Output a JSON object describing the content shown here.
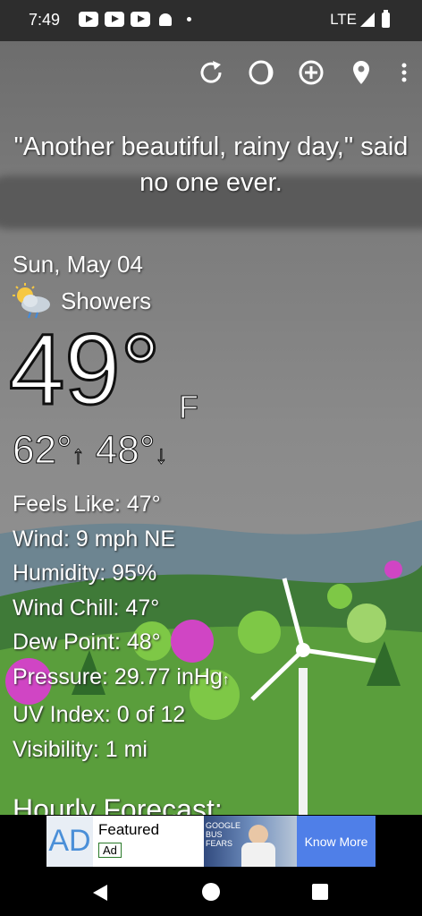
{
  "status_bar": {
    "time": "7:49",
    "network": "LTE"
  },
  "quote": "\"Another beautiful, rainy day,\" said no one ever.",
  "weather": {
    "date": "Sun, May 04",
    "condition": "Showers",
    "condition_icon": "sun-cloud-rain-icon",
    "temperature": "49°",
    "unit": "F",
    "high": "62°",
    "low": "48°",
    "details": {
      "feels_like": "Feels Like:  47°",
      "wind": "Wind:  9 mph NE",
      "humidity": "Humidity:  95%",
      "wind_chill": "Wind Chill:  47°",
      "dew_point": "Dew Point:  48°",
      "pressure": "Pressure:  29.77 inHg",
      "uv_index": "UV Index:  0 of 12",
      "visibility": "Visibility:  1 mi"
    },
    "hourly_heading": "Hourly Forecast:"
  },
  "toolbar": {
    "refresh_icon": "refresh-icon",
    "theme_icon": "moon-phase-icon",
    "add_icon": "add-location-icon",
    "location_icon": "location-pin-icon",
    "more_icon": "more-vert-icon"
  },
  "ad": {
    "logo": "AD",
    "featured": "Featured",
    "badge": "Ad",
    "image_text": "GOOGLE BUS FEARS",
    "cta": "Know More"
  },
  "colors": {
    "ad_cta": "#4f7fe8",
    "status_bar": "#2d2d2d"
  }
}
